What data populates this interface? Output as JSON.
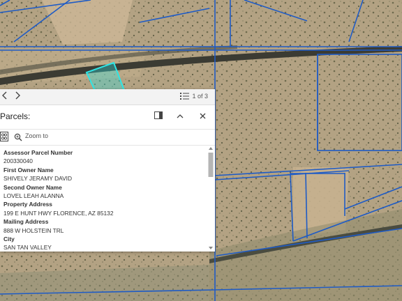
{
  "popup": {
    "prev_icon": "chevron-left-icon",
    "next_icon": "chevron-right-icon",
    "list_icon": "list-icon",
    "pager_text": "1 of 3",
    "title": "Parcels:",
    "dock_icon": "dock-icon",
    "collapse_icon": "chevron-up-icon",
    "close_icon": "close-icon",
    "select_icon": "select-features-icon",
    "zoom_icon": "zoom-icon",
    "zoom_label": "Zoom to",
    "fields": [
      {
        "label": "Assessor Parcel Number",
        "value": "200330040"
      },
      {
        "label": "First Owner Name",
        "value": "SHIVELY JERAMY DAVID"
      },
      {
        "label": "Second Owner Name",
        "value": "LOVEL LEAH ALANNA"
      },
      {
        "label": "Property Address",
        "value": "199 E HUNT HWY FLORENCE, AZ 85132"
      },
      {
        "label": "Mailing Address",
        "value": "888 W HOLSTEIN TRL"
      },
      {
        "label": "City",
        "value": "SAN TAN VALLEY"
      }
    ]
  },
  "colors": {
    "parcel_line": "#1e5bc6",
    "selected_parcel": "#2ee6e6",
    "terrain": "#b5a584"
  }
}
